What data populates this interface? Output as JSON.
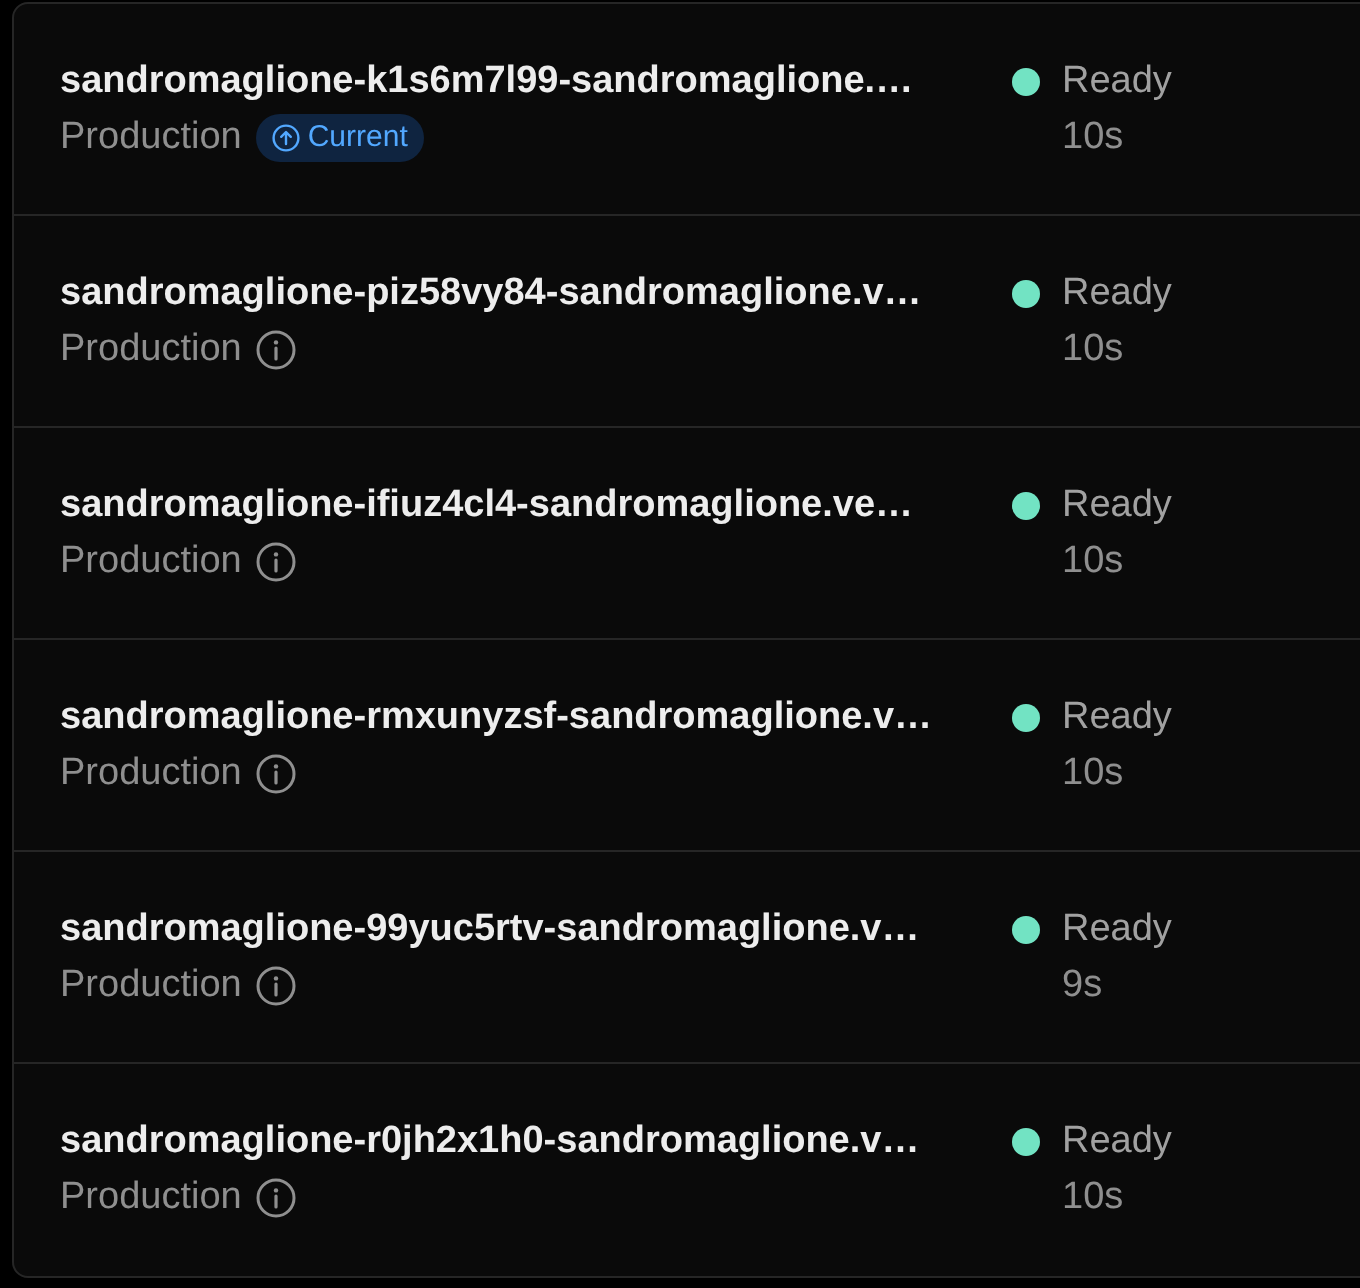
{
  "deployments": [
    {
      "name": "sandromaglione-k1s6m7l99-sandromaglione.…",
      "environment": "Production",
      "current": true,
      "badge": "Current",
      "status": "Ready",
      "color": "#72e3c3",
      "age": "10s"
    },
    {
      "name": "sandromaglione-piz58vy84-sandromaglione.v…",
      "environment": "Production",
      "current": false,
      "status": "Ready",
      "color": "#72e3c3",
      "age": "10s"
    },
    {
      "name": "sandromaglione-ifiuz4cl4-sandromaglione.ve…",
      "environment": "Production",
      "current": false,
      "status": "Ready",
      "color": "#72e3c3",
      "age": "10s"
    },
    {
      "name": "sandromaglione-rmxunyzsf-sandromaglione.v…",
      "environment": "Production",
      "current": false,
      "status": "Ready",
      "color": "#72e3c3",
      "age": "10s"
    },
    {
      "name": "sandromaglione-99yuc5rtv-sandromaglione.v…",
      "environment": "Production",
      "current": false,
      "status": "Ready",
      "color": "#72e3c3",
      "age": "9s"
    },
    {
      "name": "sandromaglione-r0jh2x1h0-sandromaglione.v…",
      "environment": "Production",
      "current": false,
      "status": "Ready",
      "color": "#72e3c3",
      "age": "10s"
    }
  ]
}
